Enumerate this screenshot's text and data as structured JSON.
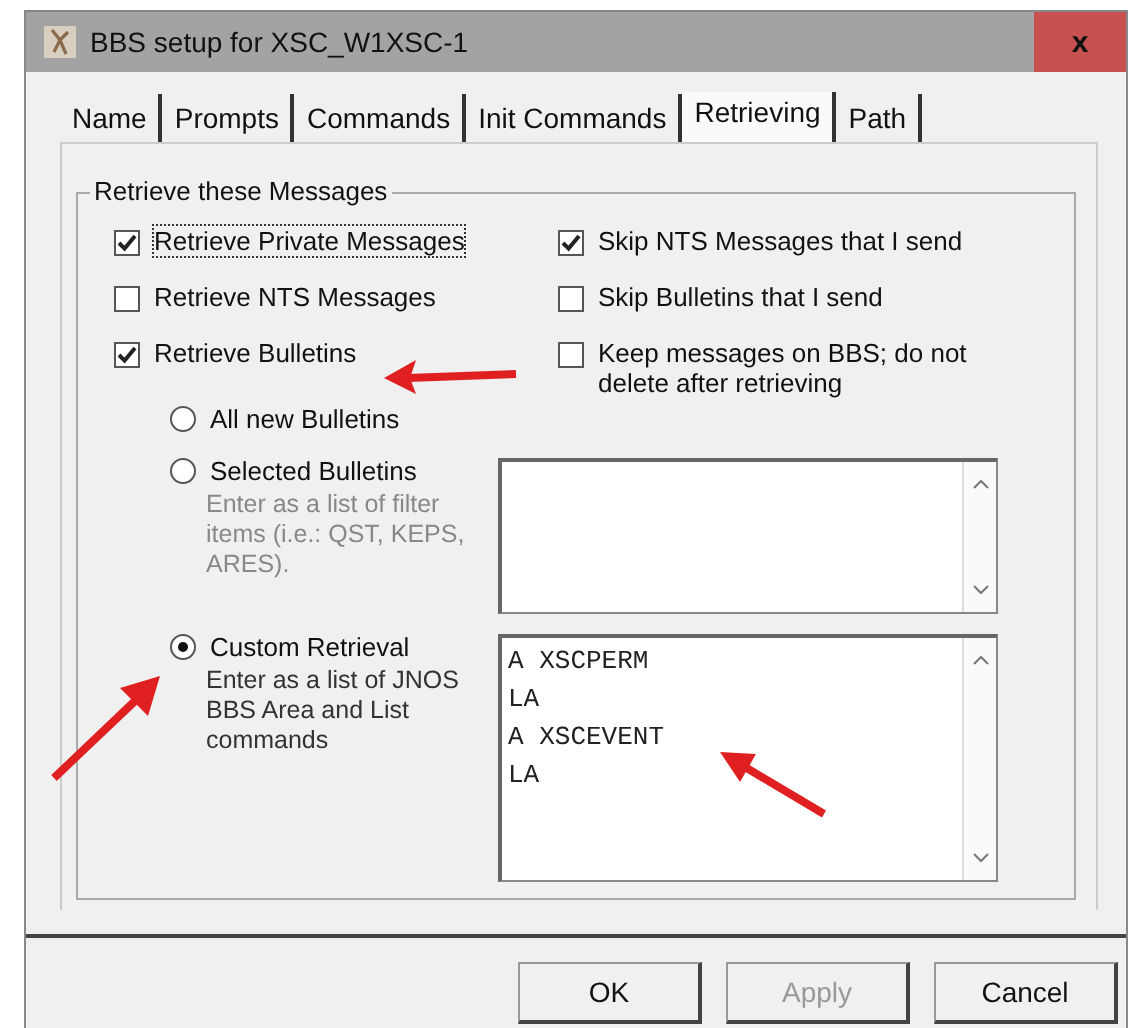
{
  "window": {
    "title": "BBS setup for XSC_W1XSC-1",
    "close": "x"
  },
  "tabs": [
    {
      "label": "Name",
      "selected": false
    },
    {
      "label": "Prompts",
      "selected": false
    },
    {
      "label": "Commands",
      "selected": false
    },
    {
      "label": "Init Commands",
      "selected": false
    },
    {
      "label": "Retrieving",
      "selected": true
    },
    {
      "label": "Path",
      "selected": false
    }
  ],
  "group": {
    "title": "Retrieve these Messages"
  },
  "left_options": [
    {
      "label": "Retrieve Private Messages",
      "checked": true,
      "focused": true
    },
    {
      "label": "Retrieve NTS Messages",
      "checked": false,
      "focused": false
    },
    {
      "label": "Retrieve Bulletins",
      "checked": true,
      "focused": false
    }
  ],
  "right_options": [
    {
      "label": "Skip NTS Messages that I send",
      "checked": true
    },
    {
      "label": "Skip Bulletins that I send",
      "checked": false
    },
    {
      "label": "Keep messages on BBS; do not delete after retrieving",
      "checked": false
    }
  ],
  "bulletin_modes": [
    {
      "label": "All new Bulletins",
      "selected": false,
      "kind": "plain"
    },
    {
      "label": "Selected Bulletins",
      "selected": false,
      "kind": "list",
      "hint": "Enter as a list of filter items (i.e.: QST, KEPS, ARES)."
    },
    {
      "label": "Custom Retrieval",
      "selected": true,
      "kind": "list",
      "hint": "Enter as a list of JNOS BBS Area and List commands",
      "lines": [
        "A XSCPERM",
        "LA",
        "A XSCEVENT",
        "LA"
      ]
    }
  ],
  "buttons": [
    {
      "label": "OK",
      "disabled": false
    },
    {
      "label": "Apply",
      "disabled": true
    },
    {
      "label": "Cancel",
      "disabled": false
    }
  ]
}
